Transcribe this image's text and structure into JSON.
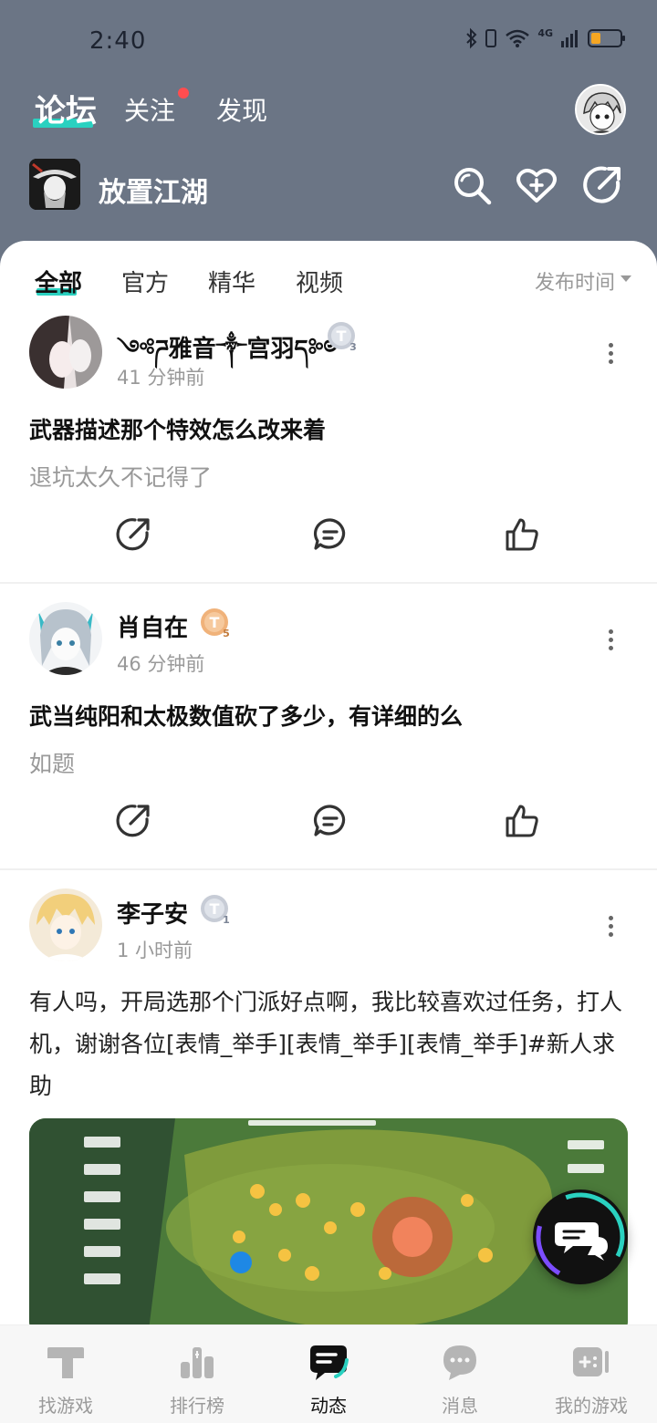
{
  "status_bar": {
    "time": "2:40",
    "network": "4G"
  },
  "top_nav": {
    "tabs": [
      "论坛",
      "关注",
      "发现"
    ],
    "active_index": 0,
    "follow_has_dot": true
  },
  "game": {
    "title": "放置江湖"
  },
  "filter": {
    "tabs": [
      "全部",
      "官方",
      "精华",
      "视频"
    ],
    "active_index": 0,
    "sort_label": "发布时间"
  },
  "posts": [
    {
      "author": "༺ཌ雅音༒宫羽ད༻",
      "time": "41 分钟前",
      "badge": {
        "letter": "T",
        "level": "3",
        "color": "#b9c0cc"
      },
      "title": "武器描述那个特效怎么改来着",
      "body": "退坑太久不记得了"
    },
    {
      "author": "肖自在",
      "time": "46 分钟前",
      "badge": {
        "letter": "T",
        "level": "5",
        "color": "#f0b27a"
      },
      "title": "武当纯阳和太极数值砍了多少，有详细的么",
      "body": "如题"
    },
    {
      "author": "李子安",
      "time": "1 小时前",
      "badge": {
        "letter": "T",
        "level": "1",
        "color": "#b9c0cc"
      },
      "body": "有人吗，开局选那个门派好点啊，我比较喜欢过任务，打人机，谢谢各位[表情_举手][表情_举手][表情_举手]#新人求助"
    }
  ],
  "bottom_nav": {
    "items": [
      "找游戏",
      "排行榜",
      "动态",
      "消息",
      "我的游戏"
    ],
    "active_index": 2
  },
  "colors": {
    "accent": "#2ad1c0",
    "header_bg": "#6b7585",
    "notify_dot": "#ff4d4f"
  }
}
